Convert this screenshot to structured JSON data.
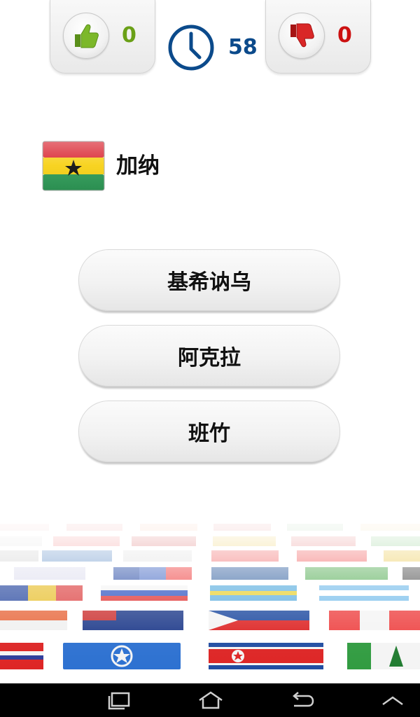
{
  "score": {
    "correct": "0",
    "wrong": "0",
    "correct_color": "#6aa017",
    "wrong_color": "#cc1111"
  },
  "timer": {
    "value": "58",
    "color": "#0b4a8b",
    "icon": "clock-icon"
  },
  "question": {
    "flag": "ghana-flag",
    "country": "加纳"
  },
  "answers": [
    {
      "label": "基希讷乌"
    },
    {
      "label": "阿克拉"
    },
    {
      "label": "班竹"
    }
  ],
  "nav": {
    "icons": [
      "recent-apps-icon",
      "home-icon",
      "back-icon",
      "menu-up-icon"
    ]
  }
}
